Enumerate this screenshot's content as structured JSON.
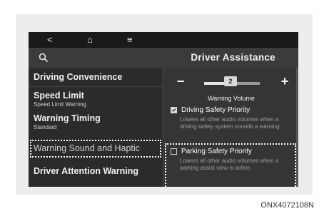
{
  "nav": {
    "back": "<",
    "home": "⌂",
    "menu": "≡"
  },
  "header": {
    "title": "Driver Assistance"
  },
  "menu": [
    {
      "label": "Driving Convenience",
      "sub": ""
    },
    {
      "label": "Speed Limit",
      "sub": "Speed Limit Warning"
    },
    {
      "label": "Warning Timing",
      "sub": "Standard"
    },
    {
      "label": "Warning Sound and Haptic",
      "sub": ""
    },
    {
      "label": "Driver Attention Warning",
      "sub": ""
    }
  ],
  "volume": {
    "minus": "−",
    "plus": "+",
    "value": "2",
    "label": "Warning Volume",
    "level_fraction": 0.42
  },
  "options": [
    {
      "title": "Driving Safety Priority",
      "desc": "Lowers all other audio volumes when a driving safety system sounds a warning.",
      "checked": true
    },
    {
      "title": "Parking Safety Priority",
      "desc": "Lowers all other audio volumes when a parking assist view is active.",
      "checked": false
    }
  ],
  "caption": "ONX4072108N"
}
